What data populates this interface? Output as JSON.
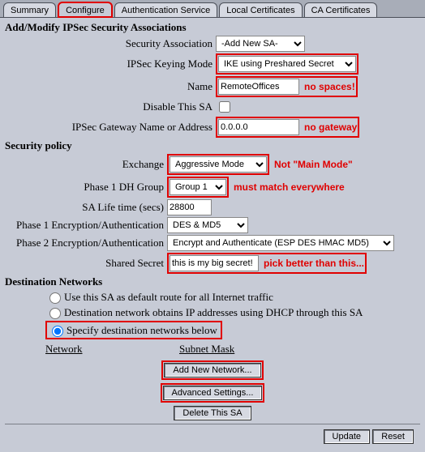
{
  "tabs": {
    "summary": "Summary",
    "configure": "Configure",
    "auth_service": "Authentication Service",
    "local_certs": "Local Certificates",
    "ca_certs": "CA Certificates"
  },
  "titles": {
    "main": "Add/Modify IPSec Security Associations",
    "security_policy": "Security policy",
    "dest_networks": "Destination Networks"
  },
  "labels": {
    "sa": "Security Association",
    "keying": "IPSec Keying Mode",
    "name": "Name",
    "disable": "Disable This SA",
    "gateway": "IPSec Gateway Name or Address",
    "exchange": "Exchange",
    "dh_group": "Phase 1 DH Group",
    "sa_life": "SA Life time (secs)",
    "p1enc": "Phase 1 Encryption/Authentication",
    "p2enc": "Phase 2 Encryption/Authentication",
    "secret": "Shared Secret"
  },
  "values": {
    "sa": "-Add New SA-",
    "keying": "IKE using Preshared Secret",
    "name": "RemoteOffices",
    "gateway": "0.0.0.0",
    "exchange": "Aggressive Mode",
    "dh_group": "Group 1",
    "sa_life": "28800",
    "p1enc": "DES & MD5",
    "p2enc": "Encrypt and Authenticate (ESP DES HMAC MD5)",
    "secret": "this is my big secret!"
  },
  "annotations": {
    "name": "no spaces!",
    "gateway": "no gateway",
    "exchange": "Not \"Main Mode\"",
    "dh_group": "must match everywhere",
    "secret": "pick better than this..."
  },
  "dest": {
    "opt1": "Use this SA as default route for all Internet traffic",
    "opt2": "Destination network obtains IP addresses using DHCP through this SA",
    "opt3": "Specify destination networks below",
    "network_hdr": "Network",
    "subnet_hdr": "Subnet Mask"
  },
  "buttons": {
    "add_net": "Add New Network...",
    "advanced": "Advanced Settings...",
    "delete": "Delete This SA",
    "update": "Update",
    "reset": "Reset"
  }
}
